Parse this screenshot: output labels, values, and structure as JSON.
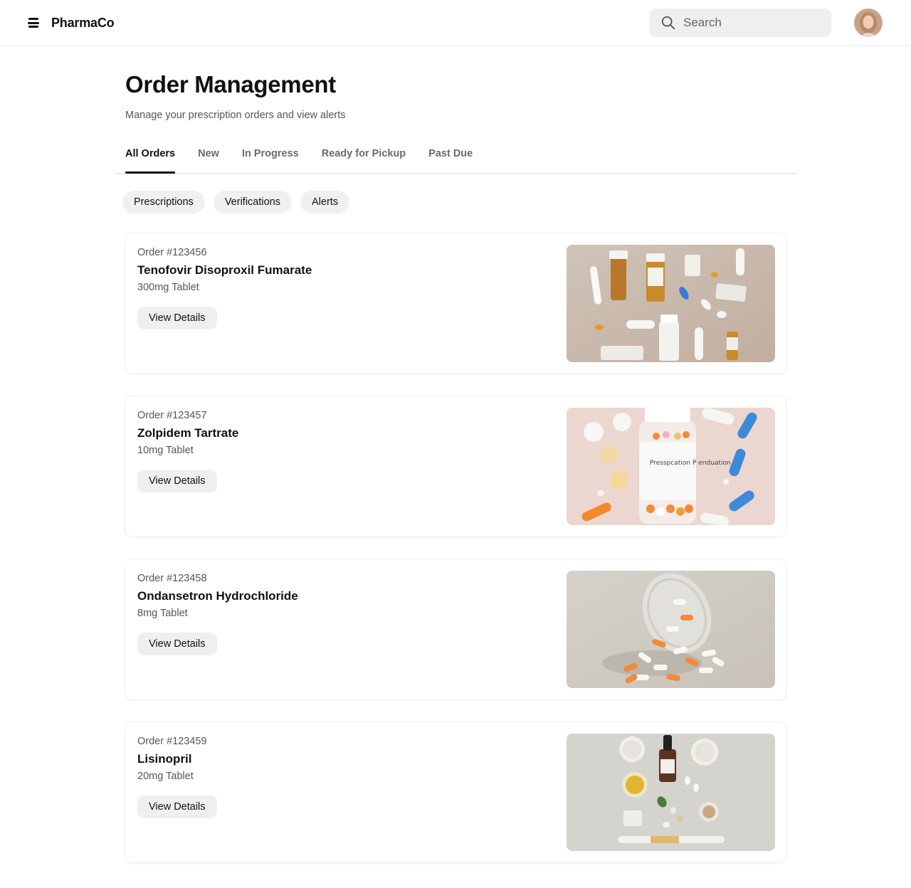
{
  "header": {
    "brand_name": "PharmaCo",
    "search_placeholder": "Search"
  },
  "page": {
    "title": "Order Management",
    "subtitle": "Manage your prescription orders and view alerts"
  },
  "tabs": [
    {
      "label": "All Orders",
      "active": true
    },
    {
      "label": "New",
      "active": false
    },
    {
      "label": "In Progress",
      "active": false
    },
    {
      "label": "Ready for Pickup",
      "active": false
    },
    {
      "label": "Past Due",
      "active": false
    }
  ],
  "chips": [
    "Prescriptions",
    "Verifications",
    "Alerts"
  ],
  "orders": [
    {
      "number": "Order #123456",
      "name": "Tenofovir Disoproxil Fumarate",
      "dose": "300mg Tablet",
      "button": "View Details"
    },
    {
      "number": "Order #123457",
      "name": "Zolpidem Tartrate",
      "dose": "10mg Tablet",
      "button": "View Details",
      "image_label": "Presspcation P enduation"
    },
    {
      "number": "Order #123458",
      "name": "Ondansetron Hydrochloride",
      "dose": "8mg Tablet",
      "button": "View Details"
    },
    {
      "number": "Order #123459",
      "name": "Lisinopril",
      "dose": "20mg Tablet",
      "button": "View Details"
    }
  ],
  "colors": {
    "text_primary": "#111111",
    "text_secondary": "#555555",
    "chip_bg": "#f0f0f0",
    "border": "#ececec"
  }
}
